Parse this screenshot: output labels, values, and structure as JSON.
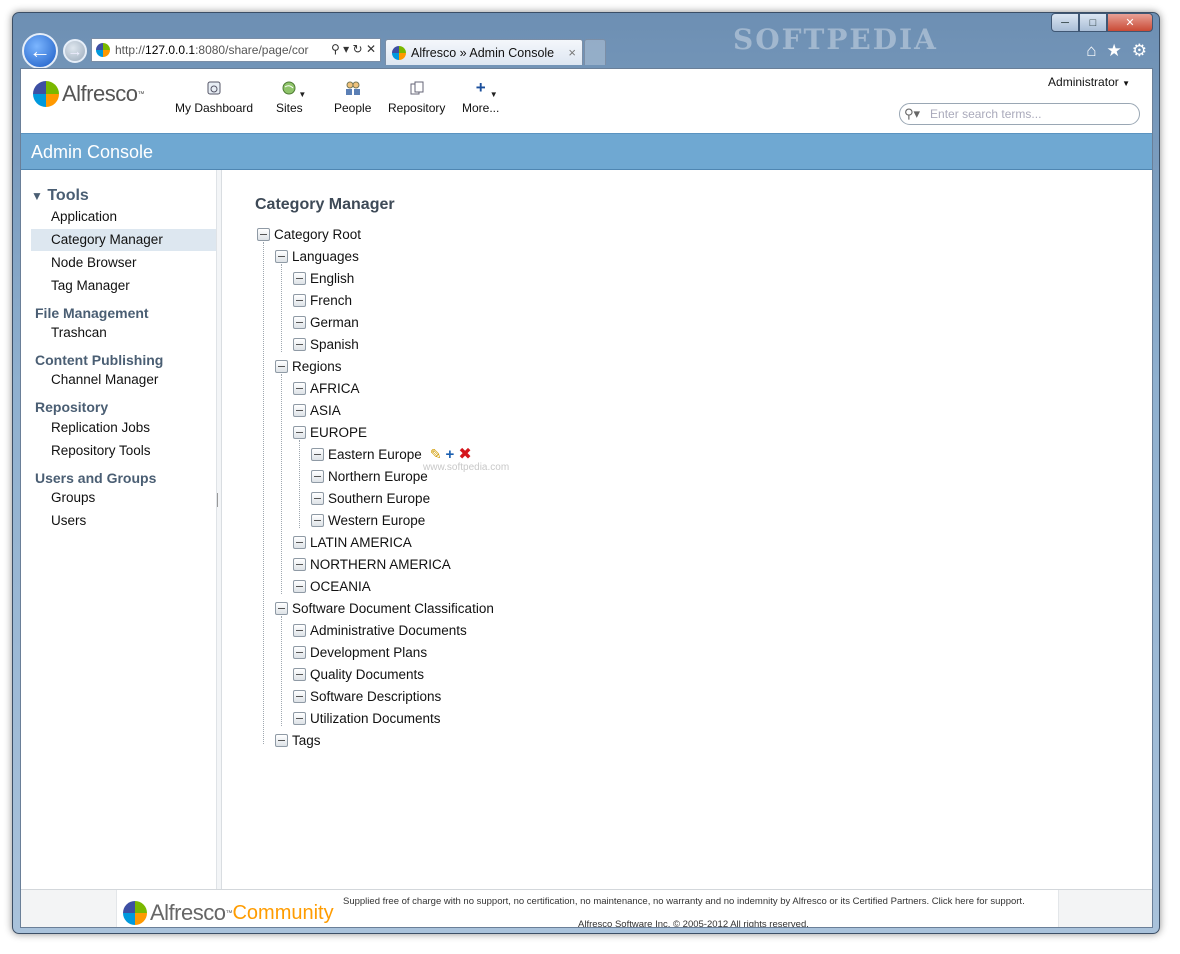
{
  "browser": {
    "address": {
      "prefix": "http://",
      "host": "127.0.0.1",
      "rest": ":8080/share/page/cor"
    },
    "tab_title": "Alfresco » Admin Console",
    "tab_close": "×",
    "watermark": "SOFTPEDIA",
    "window_controls": {
      "minimize": "─",
      "maximize": "□",
      "close": "✕"
    },
    "icons": [
      "home-icon",
      "star-icon",
      "gear-icon"
    ]
  },
  "header": {
    "logo_text": "Alfresco",
    "logo_tm": "™",
    "nav": [
      {
        "label": "My Dashboard",
        "icon": "dashboard-icon"
      },
      {
        "label": "Sites",
        "icon": "globe-icon"
      },
      {
        "label": "People",
        "icon": "people-icon"
      },
      {
        "label": "Repository",
        "icon": "repository-icon"
      },
      {
        "label": "More...",
        "icon": "plus-icon"
      }
    ],
    "user_menu": "Administrator",
    "search_placeholder": "Enter search terms..."
  },
  "page_title": "Admin Console",
  "sidebar": {
    "tools_label": "Tools",
    "tools_items": [
      "Application",
      "Category Manager",
      "Node Browser",
      "Tag Manager"
    ],
    "groups": [
      {
        "label": "File Management",
        "items": [
          "Trashcan"
        ]
      },
      {
        "label": "Content Publishing",
        "items": [
          "Channel Manager"
        ]
      },
      {
        "label": "Repository",
        "items": [
          "Replication Jobs",
          "Repository Tools"
        ]
      },
      {
        "label": "Users and Groups",
        "items": [
          "Groups",
          "Users"
        ]
      }
    ],
    "selected": "Category Manager"
  },
  "main": {
    "heading": "Category Manager",
    "tree": {
      "root": "Category Root",
      "languages": {
        "label": "Languages",
        "children": [
          "English",
          "French",
          "German",
          "Spanish"
        ]
      },
      "regions": {
        "label": "Regions",
        "africa": "AFRICA",
        "asia": "ASIA",
        "europe": "EUROPE",
        "europe_children": [
          "Eastern Europe",
          "Northern Europe",
          "Southern Europe",
          "Western Europe"
        ],
        "after": [
          "LATIN AMERICA",
          "NORTHERN AMERICA",
          "OCEANIA"
        ]
      },
      "software": {
        "label": "Software Document Classification",
        "children": [
          "Administrative Documents",
          "Development Plans",
          "Quality Documents",
          "Software Descriptions",
          "Utilization Documents"
        ]
      },
      "tags": "Tags"
    },
    "hover_watermark": "www.softpedia.com"
  },
  "footer": {
    "logo_text": "Alfresco",
    "logo_tm": "™",
    "logo_community": "Community",
    "notice": "Supplied free of charge with no support, no certification, no maintenance, no warranty and no indemnity by Alfresco or its Certified Partners. Click here for support.",
    "copyright": "Alfresco Software Inc. © 2005-2012 All rights reserved."
  }
}
